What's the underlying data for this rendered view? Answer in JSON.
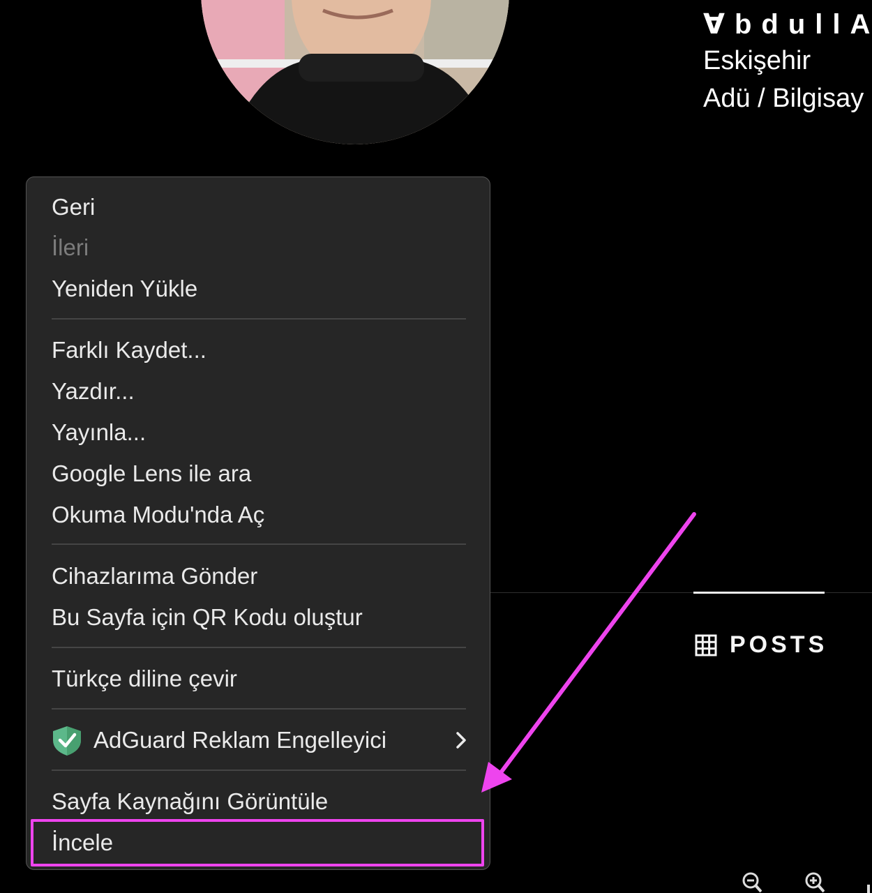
{
  "profile": {
    "name": "∀bdullAh",
    "city": "Eskişehir",
    "school": "Adü / Bilgisay"
  },
  "tabs": {
    "posts_label": "POSTS",
    "posts_icon": "grid-icon"
  },
  "context_menu": {
    "back": "Geri",
    "forward": "İleri",
    "reload": "Yeniden Yükle",
    "save_as": "Farklı Kaydet...",
    "print": "Yazdır...",
    "cast": "Yayınla...",
    "google_lens": "Google Lens ile ara",
    "reading_mode": "Okuma Modu'nda Aç",
    "send_to_devices": "Cihazlarıma Gönder",
    "qr_code": "Bu Sayfa için QR Kodu oluştur",
    "translate": "Türkçe diline çevir",
    "adguard": "AdGuard Reklam Engelleyici",
    "view_source": "Sayfa Kaynağını Görüntüle",
    "inspect": "İncele"
  },
  "colors": {
    "menu_background": "#262626",
    "annotation": "#ee44ee",
    "adguard_green": "#5cb88a"
  }
}
